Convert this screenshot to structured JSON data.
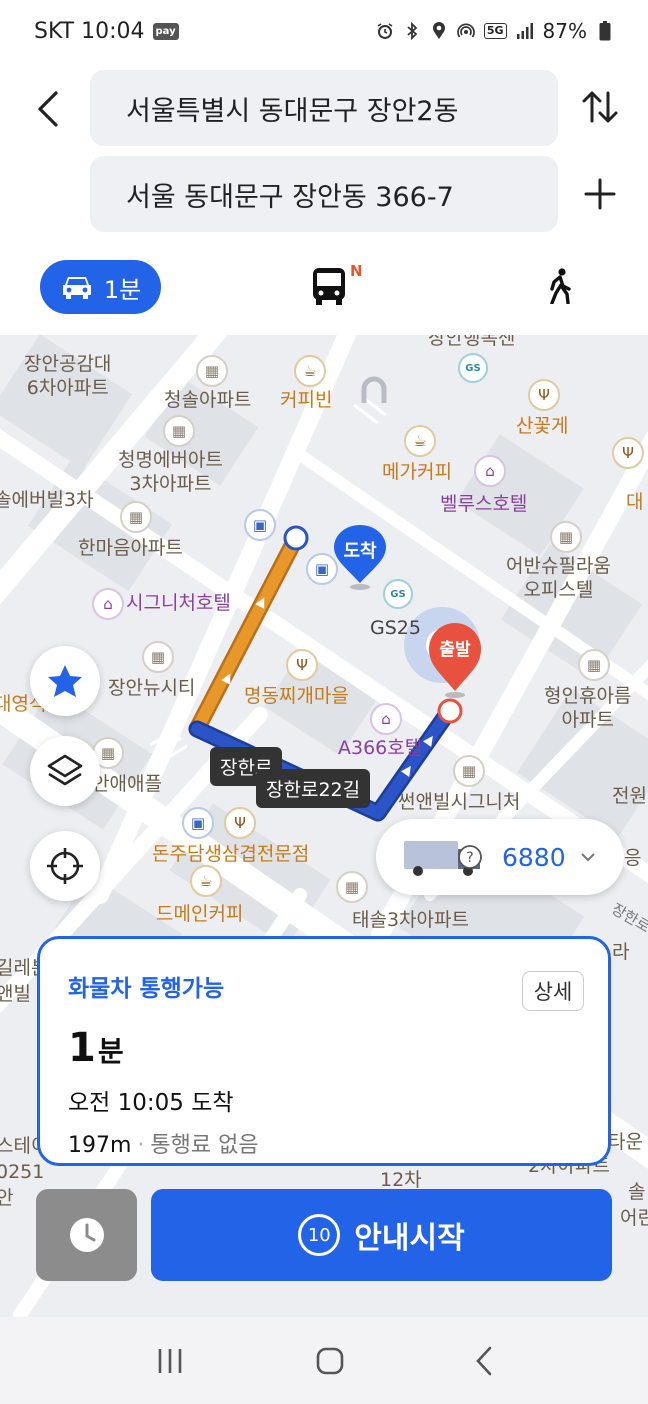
{
  "status": {
    "carrier_time": "SKT 10:04",
    "pay_badge": "pay",
    "network": "5G",
    "battery": "87%"
  },
  "search": {
    "origin": "서울특별시 동대문구 장안2동",
    "destination": "서울 동대문구 장안동 366-7"
  },
  "modes": {
    "car_time": "1분",
    "bus_badge": "N"
  },
  "map": {
    "labels": {
      "jangan_apt": "장안공감대\n6차아파트",
      "top_cut": "장안행복센",
      "cheongsol": "청솔아파트",
      "coffeebean": "커피빈",
      "sankotge": "산꽃게",
      "cheongmyeong": "청명에버아트\n3차아파트",
      "megacoffee": "메가커피",
      "bellus": "벨루스호텔",
      "dae": "대",
      "everville": "솔에버빌3차",
      "hanmaeum": "한마음아파트",
      "urban": "어반슈필라움\n오피스텔",
      "signiture_hotel": "시그니처호텔",
      "gs25": "GS25",
      "janganview": "장안뉴시티",
      "myeongdong": "명동찌개마을",
      "hyeongin": "형인휴아름\n아파트",
      "daeyeong": "대영석",
      "a366": "A366호텔",
      "anaepeul": "안애애플",
      "sunnville": "썬앤빌시그니처",
      "jeonwon": "전원",
      "donju": "돈주담생삼겹전문점",
      "eong": "응",
      "dmein": "드메인커피",
      "taesol": "태솔3차아파트",
      "janghan_side": "장한로",
      "ra": "라",
      "lefttop1": "길레븐",
      "lefttop2": "앤빌",
      "bottom_left": "스테이트장안라보니타",
      "bottom_left2": "0251",
      "bottom_left3": "안",
      "bottom_right1": "타운",
      "bottom_right2": "2차아파트",
      "bottom_right3": "솔",
      "bottom_right4": "어린",
      "bottom_mid": "12차"
    },
    "road_tags": {
      "tag1": "장한로",
      "tag2": "장한로22길"
    },
    "dest_pin": "도착",
    "start_pin": "출발",
    "truck_weight": "6880"
  },
  "route_card": {
    "title": "화물차 통행가능",
    "detail_button": "상세",
    "time_number": "1",
    "time_unit": "분",
    "arrival": "오전 10:05 도착",
    "distance": "197m",
    "separator": "·",
    "toll": "통행료 없음"
  },
  "bottom": {
    "countdown": "10",
    "start_label": "안내시작"
  },
  "colors": {
    "accent": "#2363e8",
    "route_orange": "#e8982a",
    "route_blue": "#2b54c9",
    "pin_red": "#e8513d"
  }
}
